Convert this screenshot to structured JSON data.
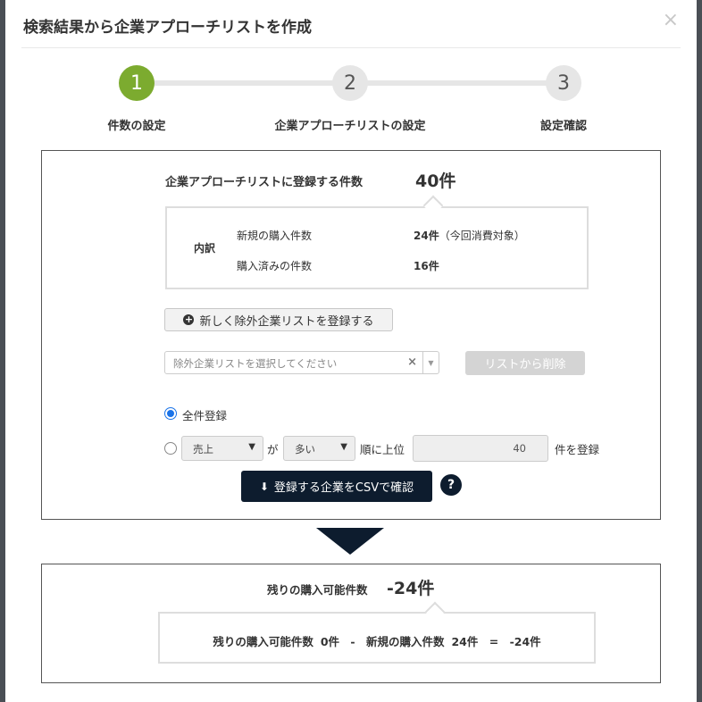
{
  "modal": {
    "title": "検索結果から企業アプローチリストを作成",
    "close": "×"
  },
  "steps": [
    {
      "number": "1",
      "label": "件数の設定",
      "active": true
    },
    {
      "number": "2",
      "label": "企業アプローチリストの設定",
      "active": false
    },
    {
      "number": "3",
      "label": "設定確認",
      "active": false
    }
  ],
  "main": {
    "count_label": "企業アプローチリストに登録する件数",
    "count_value": "40件",
    "breakdown": {
      "heading": "内訳",
      "rows": [
        {
          "label": "新規の購入件数",
          "value": "24件",
          "note": "（今回消費対象）"
        },
        {
          "label": "購入済みの件数",
          "value": "16件",
          "note": ""
        }
      ]
    },
    "register_exclusion_button": "新しく除外企業リストを登録する",
    "exclusion_select_placeholder": "除外企業リストを選択してください",
    "exclusion_select_clear": "×",
    "remove_from_list_button": "リストから削除",
    "radio_all_label": "全件登録",
    "radio_all_checked": true,
    "radio_top_checked": false,
    "sort_field": "売上",
    "particle_ga": "が",
    "sort_order": "多い",
    "top_text": "順に上位",
    "top_count": "40",
    "register_suffix": "件を登録",
    "csv_button": "登録する企業をCSVで確認",
    "help": "?"
  },
  "summary": {
    "remain_label": "残りの購入可能件数",
    "remain_value": "-24件",
    "formula": {
      "a_label": "残りの購入可能件数",
      "a_value": "0件",
      "minus": "-",
      "b_label": "新規の購入件数",
      "b_value": "24件",
      "equals": "=",
      "result": "-24件"
    }
  },
  "colors": {
    "step_active": "#7cab2f",
    "step_inactive": "#e6e6e6",
    "primary_dark": "#0d1c2e",
    "radio_blue": "#1a73e8"
  }
}
